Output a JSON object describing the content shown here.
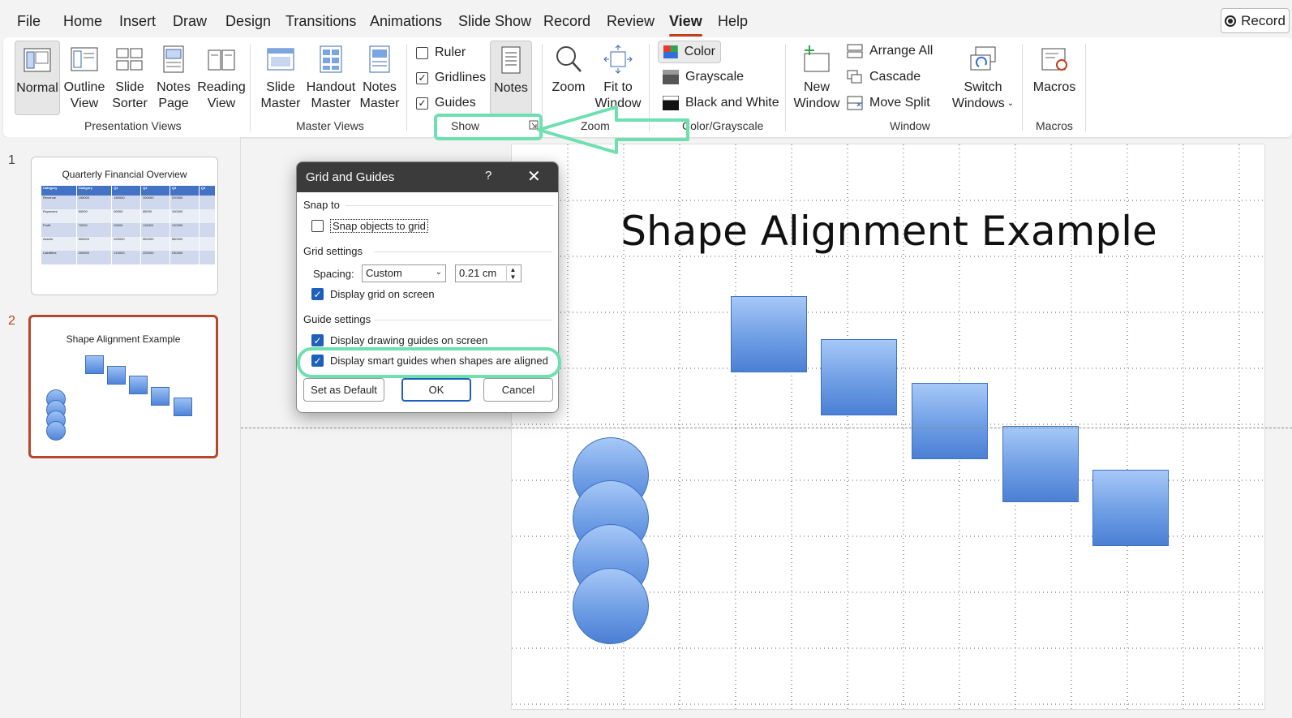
{
  "menu": {
    "items": [
      "File",
      "Home",
      "Insert",
      "Draw",
      "Design",
      "Transitions",
      "Animations",
      "Slide Show",
      "Record",
      "Review",
      "View",
      "Help"
    ],
    "active": "View",
    "record_button": "Record"
  },
  "ribbon": {
    "presentation_views": {
      "label": "Presentation Views",
      "normal": "Normal",
      "outline_1": "Outline",
      "outline_2": "View",
      "sorter_1": "Slide",
      "sorter_2": "Sorter",
      "notes_page_1": "Notes",
      "notes_page_2": "Page",
      "reading_1": "Reading",
      "reading_2": "View"
    },
    "master_views": {
      "label": "Master Views",
      "slide_1": "Slide",
      "slide_2": "Master",
      "handout_1": "Handout",
      "handout_2": "Master",
      "notes_1": "Notes",
      "notes_2": "Master"
    },
    "show": {
      "label": "Show",
      "ruler": "Ruler",
      "ruler_checked": false,
      "gridlines": "Gridlines",
      "gridlines_checked": true,
      "guides": "Guides",
      "guides_checked": true,
      "notes": "Notes"
    },
    "zoom": {
      "label": "Zoom",
      "zoom": "Zoom",
      "fit_1": "Fit to",
      "fit_2": "Window"
    },
    "color_grayscale": {
      "label": "Color/Grayscale",
      "color": "Color",
      "grayscale": "Grayscale",
      "black_white": "Black and White"
    },
    "window": {
      "label": "Window",
      "new_1": "New",
      "new_2": "Window",
      "arrange_all": "Arrange All",
      "cascade": "Cascade",
      "move_split": "Move Split",
      "switch_1": "Switch",
      "switch_2": "Windows"
    },
    "macros": {
      "label": "Macros",
      "macros": "Macros"
    }
  },
  "thumbnails": {
    "slide1": {
      "number": "1",
      "title": "Quarterly Financial Overview",
      "table_header": [
        "Category",
        "Category",
        "Q1",
        "Q2",
        "Q3",
        "Q4"
      ],
      "table_rows": [
        [
          "Revenue",
          "150000",
          "180000",
          "200000",
          "220000",
          ""
        ],
        [
          "Expenses",
          "80000",
          "90000",
          "85000",
          "100000",
          ""
        ],
        [
          "Profit",
          "70000",
          "90000",
          "115000",
          "120000",
          ""
        ],
        [
          "Assets",
          "500000",
          "520000",
          "550000",
          "580000",
          ""
        ],
        [
          "Liabilities",
          "200000",
          "210000",
          "220000",
          "230000",
          ""
        ]
      ]
    },
    "slide2": {
      "number": "2",
      "title": "Shape Alignment Example"
    }
  },
  "slide": {
    "title": "Shape Alignment Example"
  },
  "dialog": {
    "title": "Grid and Guides",
    "help": "?",
    "close": "✕",
    "snap_to": "Snap to",
    "snap_objects": "Snap objects to grid",
    "snap_objects_checked": false,
    "grid_settings": "Grid settings",
    "spacing_label": "Spacing:",
    "spacing_value": "Custom",
    "spacing_amount": "0.21 cm",
    "display_grid": "Display grid on screen",
    "display_grid_checked": true,
    "guide_settings": "Guide settings",
    "display_drawing_guides": "Display drawing guides on screen",
    "display_drawing_guides_checked": true,
    "display_smart_guides": "Display smart guides when shapes are aligned",
    "display_smart_guides_checked": true,
    "set_default": "Set as Default",
    "ok": "OK",
    "cancel": "Cancel"
  },
  "colors": {
    "accent": "#c43e1c",
    "highlight": "#6ee0b0",
    "shape_fill": "#6f9ee5",
    "checkbox_blue": "#1e5fbe"
  }
}
